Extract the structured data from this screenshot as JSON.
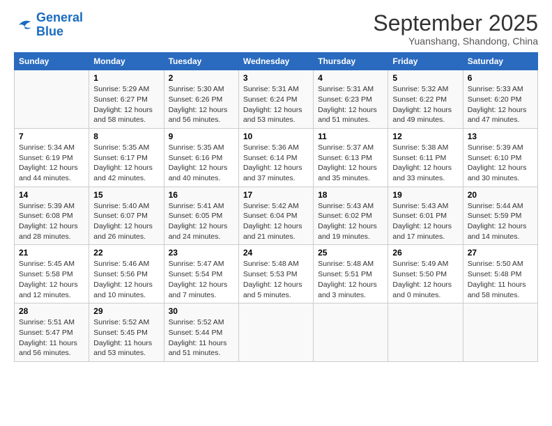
{
  "logo": {
    "line1": "General",
    "line2": "Blue"
  },
  "title": "September 2025",
  "subtitle": "Yuanshang, Shandong, China",
  "days_header": [
    "Sunday",
    "Monday",
    "Tuesday",
    "Wednesday",
    "Thursday",
    "Friday",
    "Saturday"
  ],
  "weeks": [
    [
      {
        "day": "",
        "info": ""
      },
      {
        "day": "1",
        "info": "Sunrise: 5:29 AM\nSunset: 6:27 PM\nDaylight: 12 hours\nand 58 minutes."
      },
      {
        "day": "2",
        "info": "Sunrise: 5:30 AM\nSunset: 6:26 PM\nDaylight: 12 hours\nand 56 minutes."
      },
      {
        "day": "3",
        "info": "Sunrise: 5:31 AM\nSunset: 6:24 PM\nDaylight: 12 hours\nand 53 minutes."
      },
      {
        "day": "4",
        "info": "Sunrise: 5:31 AM\nSunset: 6:23 PM\nDaylight: 12 hours\nand 51 minutes."
      },
      {
        "day": "5",
        "info": "Sunrise: 5:32 AM\nSunset: 6:22 PM\nDaylight: 12 hours\nand 49 minutes."
      },
      {
        "day": "6",
        "info": "Sunrise: 5:33 AM\nSunset: 6:20 PM\nDaylight: 12 hours\nand 47 minutes."
      }
    ],
    [
      {
        "day": "7",
        "info": "Sunrise: 5:34 AM\nSunset: 6:19 PM\nDaylight: 12 hours\nand 44 minutes."
      },
      {
        "day": "8",
        "info": "Sunrise: 5:35 AM\nSunset: 6:17 PM\nDaylight: 12 hours\nand 42 minutes."
      },
      {
        "day": "9",
        "info": "Sunrise: 5:35 AM\nSunset: 6:16 PM\nDaylight: 12 hours\nand 40 minutes."
      },
      {
        "day": "10",
        "info": "Sunrise: 5:36 AM\nSunset: 6:14 PM\nDaylight: 12 hours\nand 37 minutes."
      },
      {
        "day": "11",
        "info": "Sunrise: 5:37 AM\nSunset: 6:13 PM\nDaylight: 12 hours\nand 35 minutes."
      },
      {
        "day": "12",
        "info": "Sunrise: 5:38 AM\nSunset: 6:11 PM\nDaylight: 12 hours\nand 33 minutes."
      },
      {
        "day": "13",
        "info": "Sunrise: 5:39 AM\nSunset: 6:10 PM\nDaylight: 12 hours\nand 30 minutes."
      }
    ],
    [
      {
        "day": "14",
        "info": "Sunrise: 5:39 AM\nSunset: 6:08 PM\nDaylight: 12 hours\nand 28 minutes."
      },
      {
        "day": "15",
        "info": "Sunrise: 5:40 AM\nSunset: 6:07 PM\nDaylight: 12 hours\nand 26 minutes."
      },
      {
        "day": "16",
        "info": "Sunrise: 5:41 AM\nSunset: 6:05 PM\nDaylight: 12 hours\nand 24 minutes."
      },
      {
        "day": "17",
        "info": "Sunrise: 5:42 AM\nSunset: 6:04 PM\nDaylight: 12 hours\nand 21 minutes."
      },
      {
        "day": "18",
        "info": "Sunrise: 5:43 AM\nSunset: 6:02 PM\nDaylight: 12 hours\nand 19 minutes."
      },
      {
        "day": "19",
        "info": "Sunrise: 5:43 AM\nSunset: 6:01 PM\nDaylight: 12 hours\nand 17 minutes."
      },
      {
        "day": "20",
        "info": "Sunrise: 5:44 AM\nSunset: 5:59 PM\nDaylight: 12 hours\nand 14 minutes."
      }
    ],
    [
      {
        "day": "21",
        "info": "Sunrise: 5:45 AM\nSunset: 5:58 PM\nDaylight: 12 hours\nand 12 minutes."
      },
      {
        "day": "22",
        "info": "Sunrise: 5:46 AM\nSunset: 5:56 PM\nDaylight: 12 hours\nand 10 minutes."
      },
      {
        "day": "23",
        "info": "Sunrise: 5:47 AM\nSunset: 5:54 PM\nDaylight: 12 hours\nand 7 minutes."
      },
      {
        "day": "24",
        "info": "Sunrise: 5:48 AM\nSunset: 5:53 PM\nDaylight: 12 hours\nand 5 minutes."
      },
      {
        "day": "25",
        "info": "Sunrise: 5:48 AM\nSunset: 5:51 PM\nDaylight: 12 hours\nand 3 minutes."
      },
      {
        "day": "26",
        "info": "Sunrise: 5:49 AM\nSunset: 5:50 PM\nDaylight: 12 hours\nand 0 minutes."
      },
      {
        "day": "27",
        "info": "Sunrise: 5:50 AM\nSunset: 5:48 PM\nDaylight: 11 hours\nand 58 minutes."
      }
    ],
    [
      {
        "day": "28",
        "info": "Sunrise: 5:51 AM\nSunset: 5:47 PM\nDaylight: 11 hours\nand 56 minutes."
      },
      {
        "day": "29",
        "info": "Sunrise: 5:52 AM\nSunset: 5:45 PM\nDaylight: 11 hours\nand 53 minutes."
      },
      {
        "day": "30",
        "info": "Sunrise: 5:52 AM\nSunset: 5:44 PM\nDaylight: 11 hours\nand 51 minutes."
      },
      {
        "day": "",
        "info": ""
      },
      {
        "day": "",
        "info": ""
      },
      {
        "day": "",
        "info": ""
      },
      {
        "day": "",
        "info": ""
      }
    ]
  ]
}
